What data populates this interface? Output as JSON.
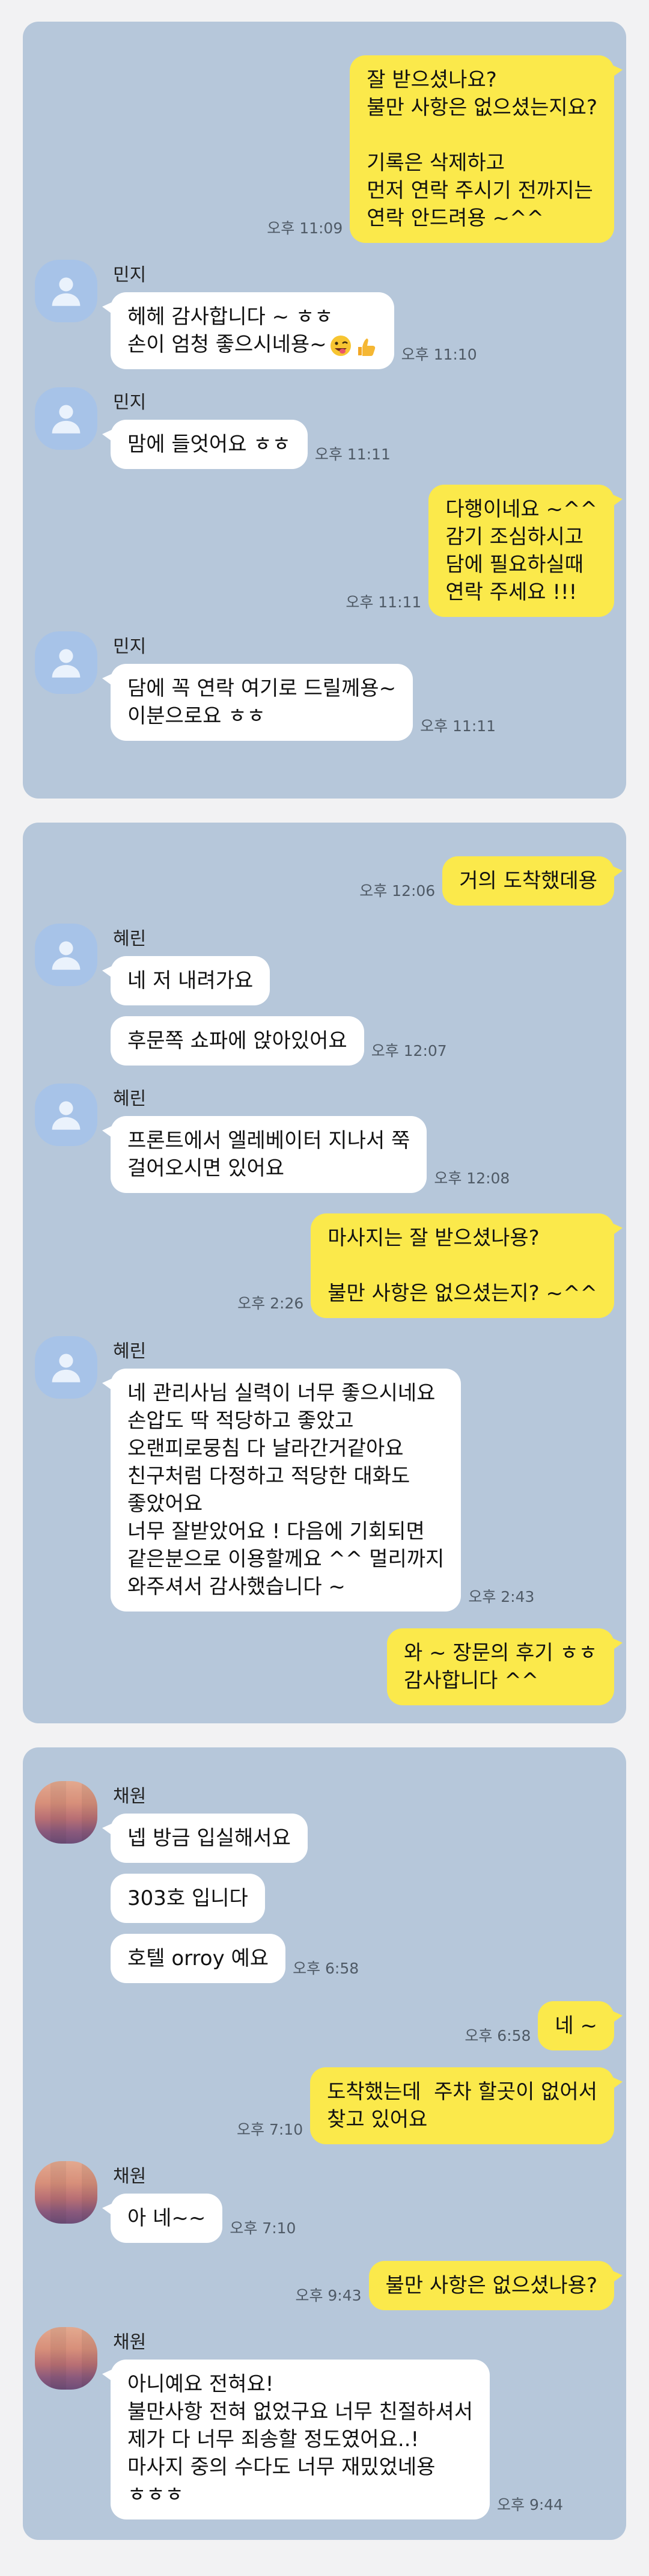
{
  "panels": [
    {
      "blocks": [
        {
          "type": "out",
          "text": "잘 받으셨나요?\n불만 사항은 없으셨는지요?\n\n기록은 삭제하고\n먼저 연락 주시기 전까지는\n연락 안드려용 ~^^",
          "time": "오후 11:09"
        },
        {
          "type": "in",
          "name": "민지",
          "avatar": "default",
          "messages": [
            {
              "text": "헤헤 감사합니다 ~ ㅎㅎ\n손이 엄청 좋으시네용~",
              "emoji": true,
              "time": "오후 11:10"
            }
          ]
        },
        {
          "type": "in",
          "name": "민지",
          "avatar": "default",
          "messages": [
            {
              "text": "맘에 들엇어요 ㅎㅎ",
              "time": "오후 11:11"
            }
          ]
        },
        {
          "type": "out",
          "text": "다행이네요 ~^^\n감기 조심하시고\n담에 필요하실때\n연락 주세요 !!!",
          "time": "오후 11:11"
        },
        {
          "type": "in",
          "name": "민지",
          "avatar": "default",
          "messages": [
            {
              "text": "담에 꼭 연락 여기로 드릴께용~\n이분으로요 ㅎㅎ",
              "time": "오후 11:11"
            }
          ]
        }
      ]
    },
    {
      "blocks": [
        {
          "type": "out",
          "text": "거의 도착했데용",
          "time": "오후 12:06"
        },
        {
          "type": "in",
          "name": "혜린",
          "avatar": "default",
          "messages": [
            {
              "text": "네 저 내려가요",
              "time": ""
            },
            {
              "text": "후문쪽 쇼파에 앉아있어요",
              "time": "오후 12:07"
            }
          ]
        },
        {
          "type": "in",
          "name": "혜린",
          "avatar": "default",
          "messages": [
            {
              "text": "프론트에서 엘레베이터 지나서 쭉\n걸어오시면 있어요",
              "time": "오후 12:08"
            }
          ]
        },
        {
          "type": "out",
          "text": "마사지는 잘 받으셨나용?\n\n불만 사항은 없으셨는지? ~^^",
          "time": "오후 2:26"
        },
        {
          "type": "in",
          "name": "혜린",
          "avatar": "default",
          "messages": [
            {
              "text": "네 관리사님 실력이 너무 좋으시네요\n손압도 딱 적당하고 좋았고\n오랜피로뭉침 다 날라간거같아요\n친구처럼 다정하고 적당한 대화도\n좋았어요\n너무 잘받았어요 ! 다음에 기회되면\n같은분으로 이용할께요 ^^ 멀리까지\n와주셔서 감사했습니다 ~",
              "time": "오후 2:43"
            }
          ]
        },
        {
          "type": "out",
          "text": "와 ~ 장문의 후기 ㅎㅎ\n감사합니다 ^^",
          "time": ""
        }
      ]
    },
    {
      "blocks": [
        {
          "type": "in",
          "name": "채원",
          "avatar": "pixel",
          "messages": [
            {
              "text": "넵 방금 입실해서요",
              "time": ""
            },
            {
              "text": "303호 입니다",
              "time": ""
            },
            {
              "text": "호텔 orroy 예요",
              "time": "오후 6:58"
            }
          ]
        },
        {
          "type": "out",
          "text": "네 ~",
          "time": "오후 6:58"
        },
        {
          "type": "out",
          "text": "도착했는데  주차 할곳이 없어서\n찾고 있어요",
          "time": "오후 7:10"
        },
        {
          "type": "in",
          "name": "채원",
          "avatar": "pixel",
          "messages": [
            {
              "text": "아 네~~",
              "time": "오후 7:10"
            }
          ]
        },
        {
          "type": "out",
          "text": "불만 사항은 없으셨나용?",
          "time": "오후 9:43"
        },
        {
          "type": "in",
          "name": "채원",
          "avatar": "pixel",
          "messages": [
            {
              "text": "아니예요 전혀요!\n불만사항 전혀 없었구요 너무 친절하셔서\n제가 다 너무 죄송할 정도였어요..!\n마사지 중의 수다도 너무 재밌었네용\nㅎㅎㅎ",
              "time": "오후 9:44"
            }
          ]
        }
      ]
    }
  ]
}
